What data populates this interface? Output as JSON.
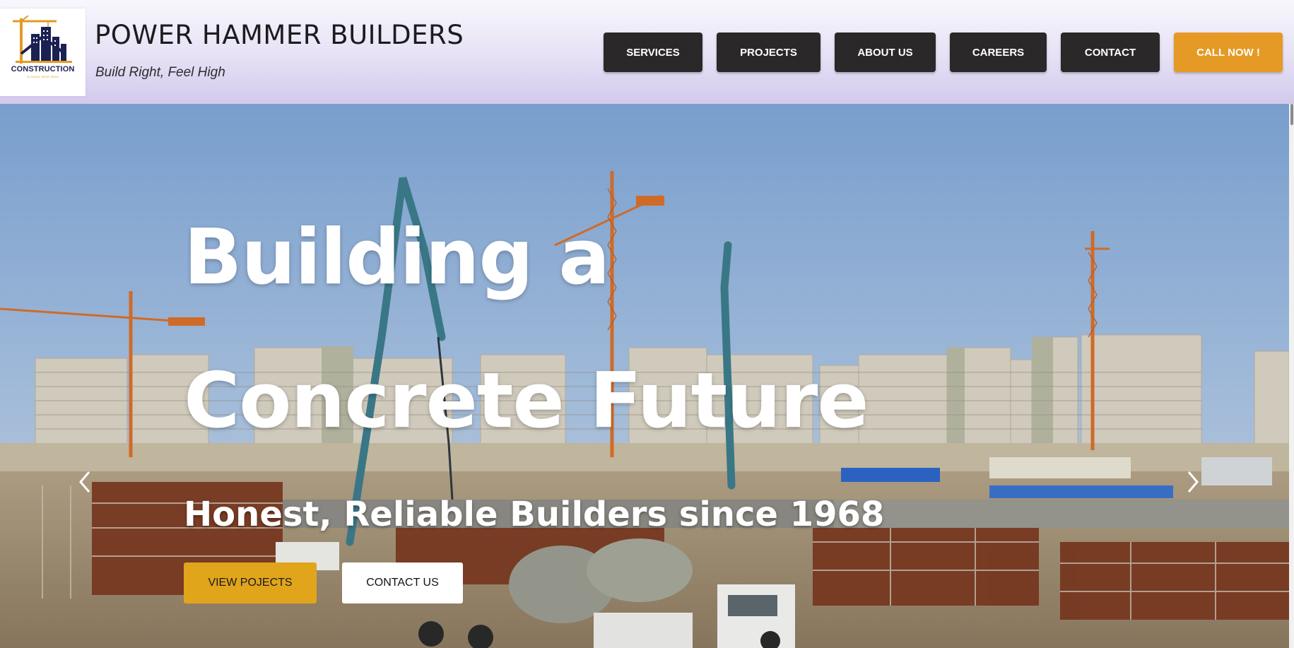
{
  "brand": {
    "logo_word": "CONSTRUCTION",
    "logo_tagline": "SLOGAN HERE MAIN",
    "title": "POWER HAMMER BUILDERS",
    "tagline": "Build Right, Feel High"
  },
  "nav": {
    "services": "SERVICES",
    "projects": "PROJECTS",
    "about": "ABOUT US",
    "careers": "CAREERS",
    "contact": "CONTACT",
    "call": "CALL NOW !"
  },
  "hero": {
    "heading_line1": "Building a",
    "heading_line2": "Concrete Future",
    "subheading": "Honest, Reliable Builders since 1968",
    "btn_projects": "VIEW POJECTS",
    "btn_contact": "CONTACT US",
    "prev_icon": "chevron-left-icon",
    "next_icon": "chevron-right-icon"
  },
  "colors": {
    "nav_bg": "#2a2828",
    "cta": "#e59a25",
    "hero_primary_btn": "#e0a51b",
    "logo_navy": "#1b2153"
  }
}
